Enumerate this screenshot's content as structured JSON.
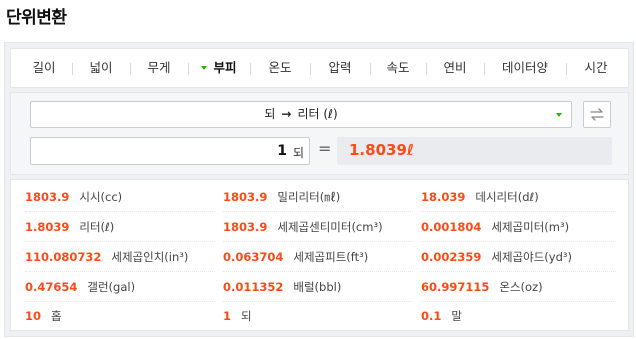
{
  "page_title": "단위변환",
  "tabs": [
    {
      "label": "길이",
      "active": false
    },
    {
      "label": "넓이",
      "active": false
    },
    {
      "label": "무게",
      "active": false
    },
    {
      "label": "부피",
      "active": true
    },
    {
      "label": "온도",
      "active": false
    },
    {
      "label": "압력",
      "active": false
    },
    {
      "label": "속도",
      "active": false
    },
    {
      "label": "연비",
      "active": false
    },
    {
      "label": "데이터양",
      "active": false
    },
    {
      "label": "시간",
      "active": false
    }
  ],
  "converter": {
    "from_unit": "되",
    "arrow": "→",
    "to_unit": "리터 (ℓ)",
    "input_value": "1",
    "input_unit": "되",
    "equals": "=",
    "result": "1.8039ℓ"
  },
  "results": [
    {
      "value": "1803.9",
      "unit": "시시(cc)"
    },
    {
      "value": "1803.9",
      "unit": "밀리리터(㎖)"
    },
    {
      "value": "18.039",
      "unit": "데시리터(dℓ)"
    },
    {
      "value": "1.8039",
      "unit": "리터(ℓ)"
    },
    {
      "value": "1803.9",
      "unit": "세제곱센티미터(cm³)"
    },
    {
      "value": "0.001804",
      "unit": "세제곱미터(m³)"
    },
    {
      "value": "110.080732",
      "unit": "세제곱인치(in³)"
    },
    {
      "value": "0.063704",
      "unit": "세제곱피트(ft³)"
    },
    {
      "value": "0.002359",
      "unit": "세제곱야드(yd³)"
    },
    {
      "value": "0.47654",
      "unit": "갤런(gal)"
    },
    {
      "value": "0.011352",
      "unit": "배럴(bbl)"
    },
    {
      "value": "60.997115",
      "unit": "온스(oz)"
    },
    {
      "value": "10",
      "unit": "홉"
    },
    {
      "value": "1",
      "unit": "되"
    },
    {
      "value": "0.1",
      "unit": "말"
    }
  ],
  "colors": {
    "accent": "#fa4b18",
    "caret": "#2db400"
  }
}
